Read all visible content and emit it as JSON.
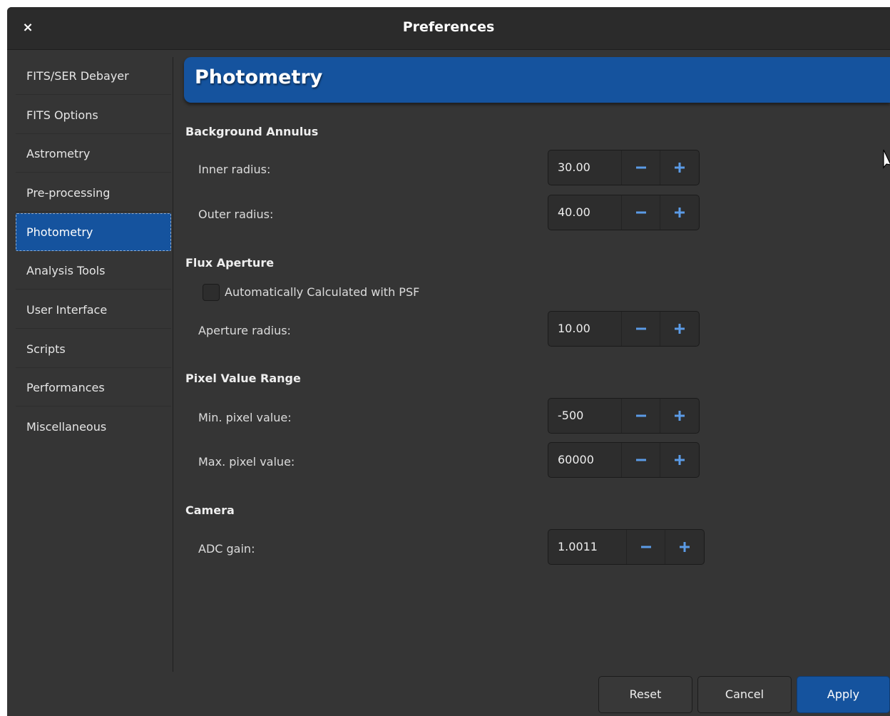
{
  "window": {
    "title": "Preferences",
    "close_glyph": "×"
  },
  "sidebar": {
    "items": [
      {
        "label": "FITS/SER Debayer"
      },
      {
        "label": "FITS Options"
      },
      {
        "label": "Astrometry"
      },
      {
        "label": "Pre-processing"
      },
      {
        "label": "Photometry",
        "active": true
      },
      {
        "label": "Analysis Tools"
      },
      {
        "label": "User Interface"
      },
      {
        "label": "Scripts"
      },
      {
        "label": "Performances"
      },
      {
        "label": "Miscellaneous"
      }
    ]
  },
  "page": {
    "title": "Photometry",
    "groups": {
      "background_annulus": {
        "heading": "Background Annulus",
        "inner_radius": {
          "label": "Inner radius:",
          "value": "30.00"
        },
        "outer_radius": {
          "label": "Outer radius:",
          "value": "40.00"
        }
      },
      "flux_aperture": {
        "heading": "Flux Aperture",
        "auto_psf": {
          "label": "Automatically Calculated with PSF",
          "checked": false
        },
        "aperture_radius": {
          "label": "Aperture radius:",
          "value": "10.00"
        }
      },
      "pixel_value_range": {
        "heading": "Pixel Value Range",
        "min_pixel": {
          "label": "Min. pixel value:",
          "value": "-500"
        },
        "max_pixel": {
          "label": "Max. pixel value:",
          "value": "60000"
        }
      },
      "camera": {
        "heading": "Camera",
        "adc_gain": {
          "label": "ADC gain:",
          "value": "1.0011"
        }
      }
    }
  },
  "buttons": {
    "reset": "Reset",
    "cancel": "Cancel",
    "apply": "Apply"
  },
  "icons": {
    "minus": "minus-icon",
    "plus": "plus-icon",
    "close": "close-icon",
    "cursor": "mouse-pointer-icon"
  },
  "colors": {
    "accent": "#15539e",
    "background": "#353535",
    "titlebar": "#2b2b2b",
    "icon_blue": "#5b9be6"
  }
}
